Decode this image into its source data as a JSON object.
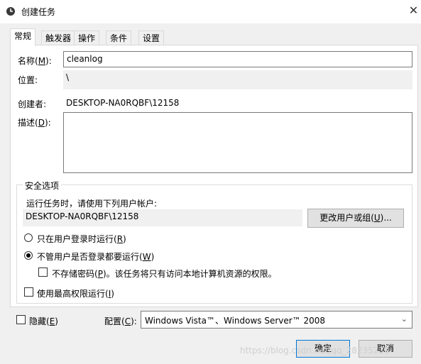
{
  "window": {
    "title": "创建任务",
    "close_glyph": "✕"
  },
  "tabs": [
    {
      "label": "常规",
      "active": true
    },
    {
      "label": "触发器"
    },
    {
      "label": "操作"
    },
    {
      "label": "条件"
    },
    {
      "label": "设置"
    }
  ],
  "general": {
    "name_label_pre": "名称(",
    "name_label_key": "M",
    "name_label_post": "):",
    "name_value": "cleanlog",
    "location_label": "位置:",
    "location_value": "\\",
    "author_label": "创建者:",
    "author_value": "DESKTOP-NA0RQBF\\12158",
    "desc_label_pre": "描述(",
    "desc_label_key": "D",
    "desc_label_post": "):",
    "desc_value": ""
  },
  "security": {
    "group_title": "安全选项",
    "run_as_prompt": "运行任务时，请使用下列用户帐户:",
    "user_account": "DESKTOP-NA0RQBF\\12158",
    "change_user_button_pre": "更改用户或组(",
    "change_user_button_key": "U",
    "change_user_button_post": ")...",
    "radio_logged_on_pre": "只在用户登录时运行(",
    "radio_logged_on_key": "R",
    "radio_logged_on_post": ")",
    "radio_logged_on_selected": false,
    "radio_any_pre": "不管用户是否登录都要运行(",
    "radio_any_key": "W",
    "radio_any_post": ")",
    "radio_any_selected": true,
    "no_store_pw_pre": "不存储密码(",
    "no_store_pw_key": "P",
    "no_store_pw_post": ")。该任务将只有访问本地计算机资源的权限。",
    "no_store_pw_checked": false,
    "highest_priv_pre": "使用最高权限运行(",
    "highest_priv_key": "I",
    "highest_priv_post": ")",
    "highest_priv_checked": false
  },
  "footer": {
    "hidden_pre": "隐藏(",
    "hidden_key": "E",
    "hidden_post": ")",
    "hidden_checked": false,
    "configure_pre": "配置(",
    "configure_key": "C",
    "configure_post": "):",
    "configure_value": "Windows Vista™、Windows Server™ 2008",
    "ok_button": "确定",
    "cancel_button": "取消"
  },
  "watermark_text": "https://blog.csdn.net/qq_28235239",
  "colors": {
    "panel_bg": "#ffffff",
    "dialog_bg": "#f0f0f0",
    "button_bg": "#e1e1e1",
    "ok_border": "#0078d7"
  }
}
